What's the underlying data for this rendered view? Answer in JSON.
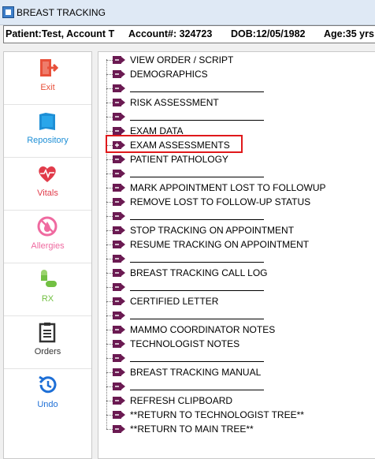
{
  "window": {
    "title": "BREAST TRACKING"
  },
  "patient": {
    "name": "Patient:Test, Account T",
    "account": "Account#:  324723",
    "dob": "DOB:12/05/1982",
    "age": "Age:35 yrs"
  },
  "sidebar": {
    "items": [
      {
        "label": "Exit",
        "icon": "exit-icon",
        "color": "#e8503a"
      },
      {
        "label": "Repository",
        "icon": "repository-icon",
        "color": "#1e8fd6"
      },
      {
        "label": "Vitals",
        "icon": "vitals-icon",
        "color": "#e13b4a"
      },
      {
        "label": "Allergies",
        "icon": "allergies-icon",
        "color": "#ef6aa0"
      },
      {
        "label": "RX",
        "icon": "rx-icon",
        "color": "#72c043"
      },
      {
        "label": "Orders",
        "icon": "orders-icon",
        "color": "#333333"
      },
      {
        "label": "Undo",
        "icon": "undo-icon",
        "color": "#1e6fd6"
      }
    ]
  },
  "tree": {
    "items": [
      {
        "label": "VIEW ORDER / SCRIPT",
        "blank": false,
        "expanded": false
      },
      {
        "label": "DEMOGRAPHICS",
        "blank": false,
        "expanded": false
      },
      {
        "label": "",
        "blank": true,
        "expanded": false
      },
      {
        "label": "RISK ASSESSMENT",
        "blank": false,
        "expanded": false
      },
      {
        "label": "",
        "blank": true,
        "expanded": false
      },
      {
        "label": "EXAM DATA",
        "blank": false,
        "expanded": false
      },
      {
        "label": "EXAM ASSESSMENTS",
        "blank": false,
        "expanded": true
      },
      {
        "label": "PATIENT PATHOLOGY",
        "blank": false,
        "expanded": false
      },
      {
        "label": "",
        "blank": true,
        "expanded": false
      },
      {
        "label": "MARK APPOINTMENT LOST TO FOLLOWUP",
        "blank": false,
        "expanded": false
      },
      {
        "label": "REMOVE LOST TO FOLLOW-UP STATUS",
        "blank": false,
        "expanded": false
      },
      {
        "label": "",
        "blank": true,
        "expanded": false
      },
      {
        "label": "STOP TRACKING ON APPOINTMENT",
        "blank": false,
        "expanded": false
      },
      {
        "label": "RESUME TRACKING ON APPOINTMENT",
        "blank": false,
        "expanded": false
      },
      {
        "label": "",
        "blank": true,
        "expanded": false
      },
      {
        "label": "BREAST TRACKING CALL LOG",
        "blank": false,
        "expanded": false
      },
      {
        "label": "",
        "blank": true,
        "expanded": false
      },
      {
        "label": "CERTIFIED  LETTER",
        "blank": false,
        "expanded": false
      },
      {
        "label": "",
        "blank": true,
        "expanded": false
      },
      {
        "label": "MAMMO COORDINATOR NOTES",
        "blank": false,
        "expanded": false
      },
      {
        "label": "TECHNOLOGIST NOTES",
        "blank": false,
        "expanded": false
      },
      {
        "label": "",
        "blank": true,
        "expanded": false
      },
      {
        "label": "BREAST TRACKING MANUAL",
        "blank": false,
        "expanded": false
      },
      {
        "label": "",
        "blank": true,
        "expanded": false
      },
      {
        "label": "REFRESH CLIPBOARD",
        "blank": false,
        "expanded": false
      },
      {
        "label": "**RETURN TO TECHNOLOGIST TREE**",
        "blank": false,
        "expanded": false
      },
      {
        "label": "**RETURN TO MAIN TREE**",
        "blank": false,
        "expanded": false
      }
    ],
    "node_icon_color": "#6b1a52",
    "highlight_color": "#e0191b"
  }
}
